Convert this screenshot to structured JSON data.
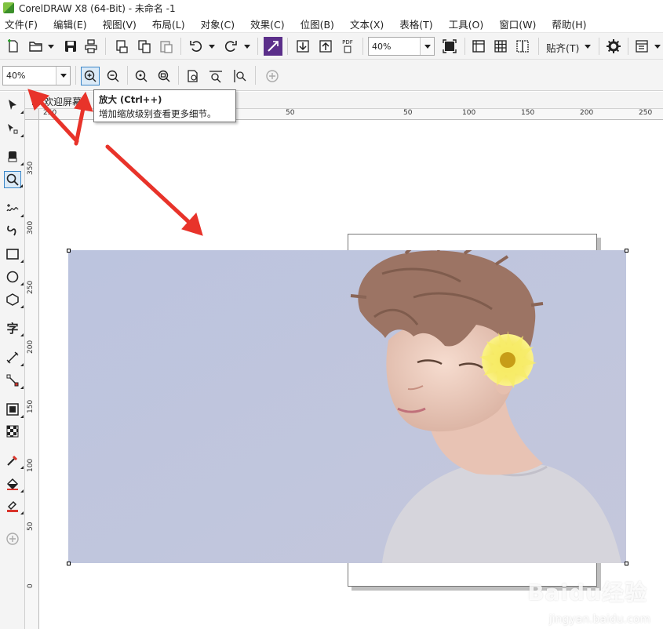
{
  "window": {
    "title": "CorelDRAW X8 (64-Bit) - 未命名 -1"
  },
  "menu": [
    "文件(F)",
    "编辑(E)",
    "视图(V)",
    "布局(L)",
    "对象(C)",
    "效果(C)",
    "位图(B)",
    "文本(X)",
    "表格(T)",
    "工具(O)",
    "窗口(W)",
    "帮助(H)"
  ],
  "toolbar": {
    "zoom_value": "40%",
    "snap_label": "贴齐(T)",
    "pdf_label": "PDF"
  },
  "property_bar": {
    "zoom_value": "40%"
  },
  "tooltip": {
    "title": "放大 (Ctrl++)",
    "description": "增加缩放级别查看更多细节。"
  },
  "doc_tabs": [
    {
      "label": "欢迎屏幕"
    }
  ],
  "toolbox": {
    "text_tool_glyph": "字",
    "items": [
      "pick-tool",
      "shape-tool",
      "crop-tool",
      "zoom-tool",
      "freehand-tool",
      "artistic-media-tool",
      "rectangle-tool",
      "ellipse-tool",
      "polygon-tool",
      "text-tool",
      "parallel-dimension-tool",
      "connector-tool",
      "drop-shadow-tool",
      "transparency-tool",
      "color-eyedropper-tool",
      "interactive-fill-tool",
      "smart-fill-tool",
      "add-tool"
    ]
  },
  "ruler_h": {
    "labels": [
      "250",
      "200",
      "50",
      "50",
      "100",
      "150",
      "200",
      "250"
    ]
  },
  "ruler_v": {
    "labels": [
      "350",
      "300",
      "250",
      "200",
      "150",
      "100",
      "50",
      "0"
    ]
  },
  "watermark": {
    "main": "Baidu经验",
    "sub": "jingyan.baidu.com"
  },
  "colors": {
    "accent": "#3a86c8",
    "annotation_red": "#e8332a",
    "photo_bg": "#bcc3dc"
  }
}
